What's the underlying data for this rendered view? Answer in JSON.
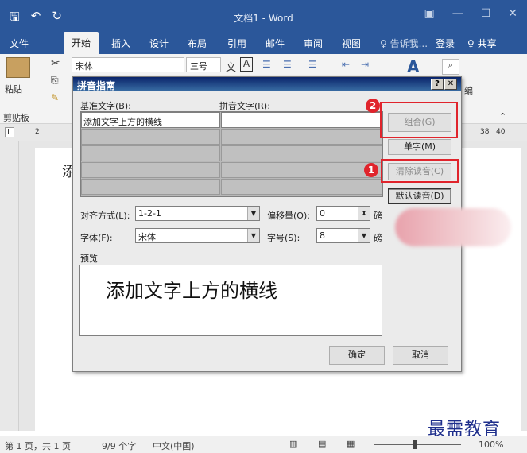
{
  "window": {
    "title": "文档1 - Word",
    "qat": [
      "🖫",
      "↶",
      "↻"
    ],
    "controls": [
      "▣",
      "—",
      "☐",
      "✕"
    ]
  },
  "tabs": [
    {
      "label": "文件"
    },
    {
      "label": "开始"
    },
    {
      "label": "插入"
    },
    {
      "label": "设计"
    },
    {
      "label": "布局"
    },
    {
      "label": "引用"
    },
    {
      "label": "邮件"
    },
    {
      "label": "审阅"
    },
    {
      "label": "视图"
    }
  ],
  "tell_me": "♀ 告诉我...",
  "signin": "登录",
  "share": "♀ 共享",
  "ribbon": {
    "font_name": "宋体",
    "font_size": "三号",
    "paste_label": "粘贴",
    "clipboard_label": "剪贴板",
    "find_frag": "编"
  },
  "ruler": {
    "corner": "L",
    "left_num": "2",
    "right_nums": [
      "38",
      "40"
    ]
  },
  "doc_text_char": "添",
  "dialog": {
    "title": "拼音指南",
    "help": "?",
    "close": "✕",
    "base_label": "基准文字(B):",
    "ruby_label": "拼音文字(R):",
    "base_first": "添加文字上方的横线",
    "btn_group": "组合(G)",
    "btn_single": "单字(M)",
    "btn_clear": "清除读音(C)",
    "btn_default": "默认读音(D)",
    "align_label": "对齐方式(L):",
    "align_value": "1-2-1",
    "offset_label": "偏移量(O):",
    "offset_value": "0",
    "offset_unit": "磅",
    "font_label": "字体(F):",
    "font_value": "宋体",
    "size_label": "字号(S):",
    "size_value": "8",
    "size_unit": "磅",
    "preview_label": "预览",
    "preview_text": "添加文字上方的横线",
    "ok": "确定",
    "cancel": "取消"
  },
  "annotations": {
    "one": "1",
    "two": "2"
  },
  "status": {
    "page": "第 1 页，共 1 页",
    "words": "9/9 个字",
    "lang": "中文(中国)",
    "zoom": "100%"
  },
  "watermark": "最需教育"
}
